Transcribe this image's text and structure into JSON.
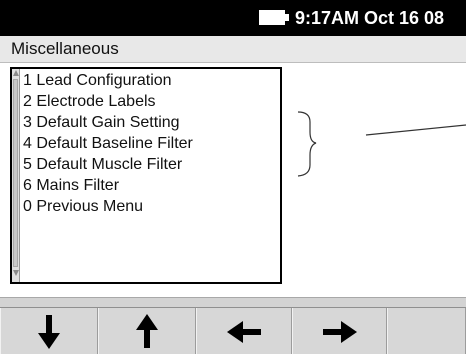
{
  "status_bar": {
    "time_date": "9:17AM Oct 16 08",
    "battery_icon": "battery-icon"
  },
  "title_bar": {
    "title": "Miscellaneous"
  },
  "menu": {
    "items": [
      {
        "label": "1 Lead Configuration"
      },
      {
        "label": "2 Electrode Labels"
      },
      {
        "label": "3 Default Gain Setting"
      },
      {
        "label": "4 Default Baseline Filter"
      },
      {
        "label": "5 Default Muscle Filter"
      },
      {
        "label": "6 Mains Filter"
      },
      {
        "label": "0 Previous Menu"
      }
    ]
  },
  "softkeys": [
    {
      "icon": "arrow-down-icon"
    },
    {
      "icon": "arrow-up-icon"
    },
    {
      "icon": "arrow-left-icon"
    },
    {
      "icon": "arrow-right-icon"
    },
    {
      "icon": ""
    }
  ],
  "colors": {
    "status_bar_bg": "#000000",
    "title_bar_bg": "#e8e8e8",
    "softkey_bg": "#d3d3d3"
  }
}
